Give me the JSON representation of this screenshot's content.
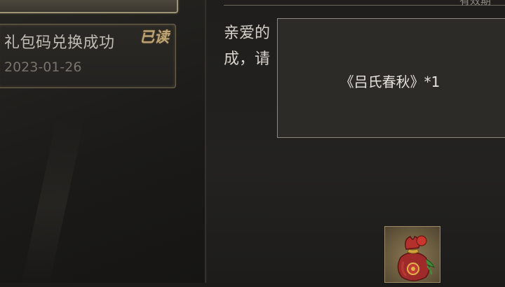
{
  "mail_list": {
    "items": [
      {
        "title": "礼包码兑换成功",
        "date": "2023-01-26",
        "status": "已读"
      }
    ]
  },
  "detail": {
    "header_partial": "有效期",
    "body_lines": [
      "亲爱的",
      "成，请"
    ]
  },
  "tooltip": {
    "text": "《吕氏春秋》*1"
  },
  "reward": {
    "icon": "lucky-bag-icon"
  }
}
